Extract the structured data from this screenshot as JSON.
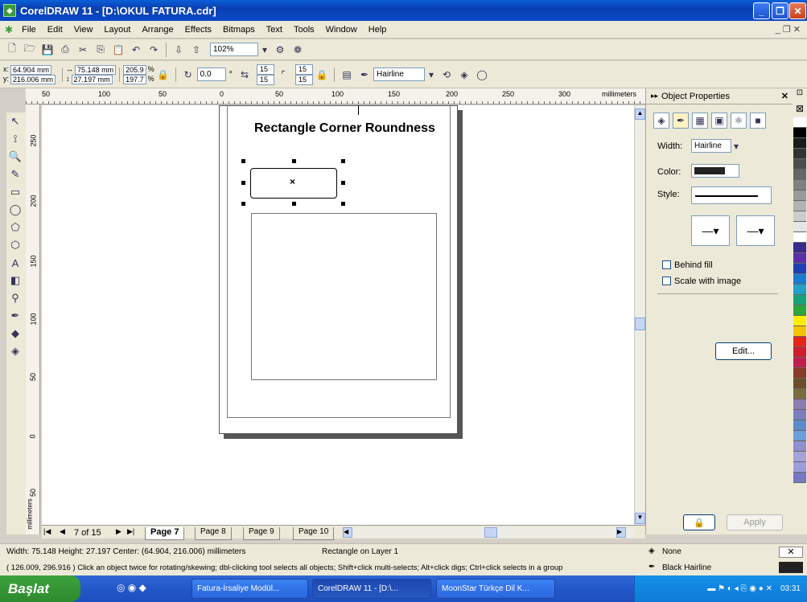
{
  "window": {
    "title": "CorelDRAW 11 - [D:\\OKUL FATURA.cdr]"
  },
  "menu": [
    "File",
    "Edit",
    "View",
    "Layout",
    "Arrange",
    "Effects",
    "Bitmaps",
    "Text",
    "Tools",
    "Window",
    "Help"
  ],
  "standard_toolbar": {
    "zoom": "102%"
  },
  "property_bar": {
    "x": "64.904 mm",
    "y": "216.006 mm",
    "width": "75.148 mm",
    "height": "27.197 mm",
    "scale_x": "205.9",
    "scale_y": "197.7",
    "pct": "%",
    "rotation": "0.0",
    "rotation_unit": "°",
    "corner_tl": "15",
    "corner_bl": "15",
    "corner_tr": "15",
    "corner_br": "15",
    "outline": "Hairline"
  },
  "ruler": {
    "units": "millimeters",
    "h_ticks": [
      "50",
      "100",
      "50",
      "0",
      "50",
      "100",
      "150",
      "200",
      "250",
      "300"
    ],
    "v_ticks": [
      "250",
      "200",
      "150",
      "100",
      "50",
      "0",
      "50"
    ],
    "v_units": "millimeters"
  },
  "canvas": {
    "heading": "Rectangle Corner Roundness"
  },
  "pages": {
    "counter": "7 of 15",
    "tabs": [
      "Page 7",
      "Page 8",
      "Page 9",
      "Page 10"
    ]
  },
  "docker": {
    "title": "Object Properties",
    "width_label": "Width:",
    "width_value": "Hairline",
    "color_label": "Color:",
    "style_label": "Style:",
    "behind_fill": "Behind fill",
    "scale_with_image": "Scale with image",
    "edit_button": "Edit...",
    "apply_button": "Apply"
  },
  "palette_colors": [
    "#ffffff",
    "#000000",
    "#1a1a1a",
    "#333333",
    "#4d4d4d",
    "#666666",
    "#808080",
    "#999999",
    "#b3b3b3",
    "#cccccc",
    "#e6e6e6",
    "#ffffff",
    "#3b2a8c",
    "#5a2fa8",
    "#1f3fb5",
    "#1c7bd0",
    "#23a0c8",
    "#17a27a",
    "#2aa63a",
    "#ffee00",
    "#f5c400",
    "#e8231a",
    "#d01c2c",
    "#c02050",
    "#8a3a2a",
    "#6b4e2e",
    "#7a6a40",
    "#8c7cb0",
    "#7d7dbf",
    "#5d8ac8",
    "#6a9fd8",
    "#8f8fcf",
    "#a4a4d8",
    "#9d9ddd",
    "#7878c0"
  ],
  "status": {
    "line1_left": "Width: 75.148 Height: 27.197 Center: (64.904, 216.006) millimeters",
    "line1_mid": "Rectangle on Layer 1",
    "line2": "( 126.009, 296.916 )     Click an object twice for rotating/skewing; dbl-clicking tool selects all objects; Shift+click multi-selects; Alt+click digs; Ctrl+click selects in a group",
    "fill": "None",
    "outline": "Black  Hairline"
  },
  "taskbar": {
    "start": "Başlat",
    "tasks": [
      "Fatura-İrsaliye Modül...",
      "CorelDRAW 11 - [D:\\...",
      "MoonStar Türkçe Dil K..."
    ],
    "clock": "03:31"
  }
}
